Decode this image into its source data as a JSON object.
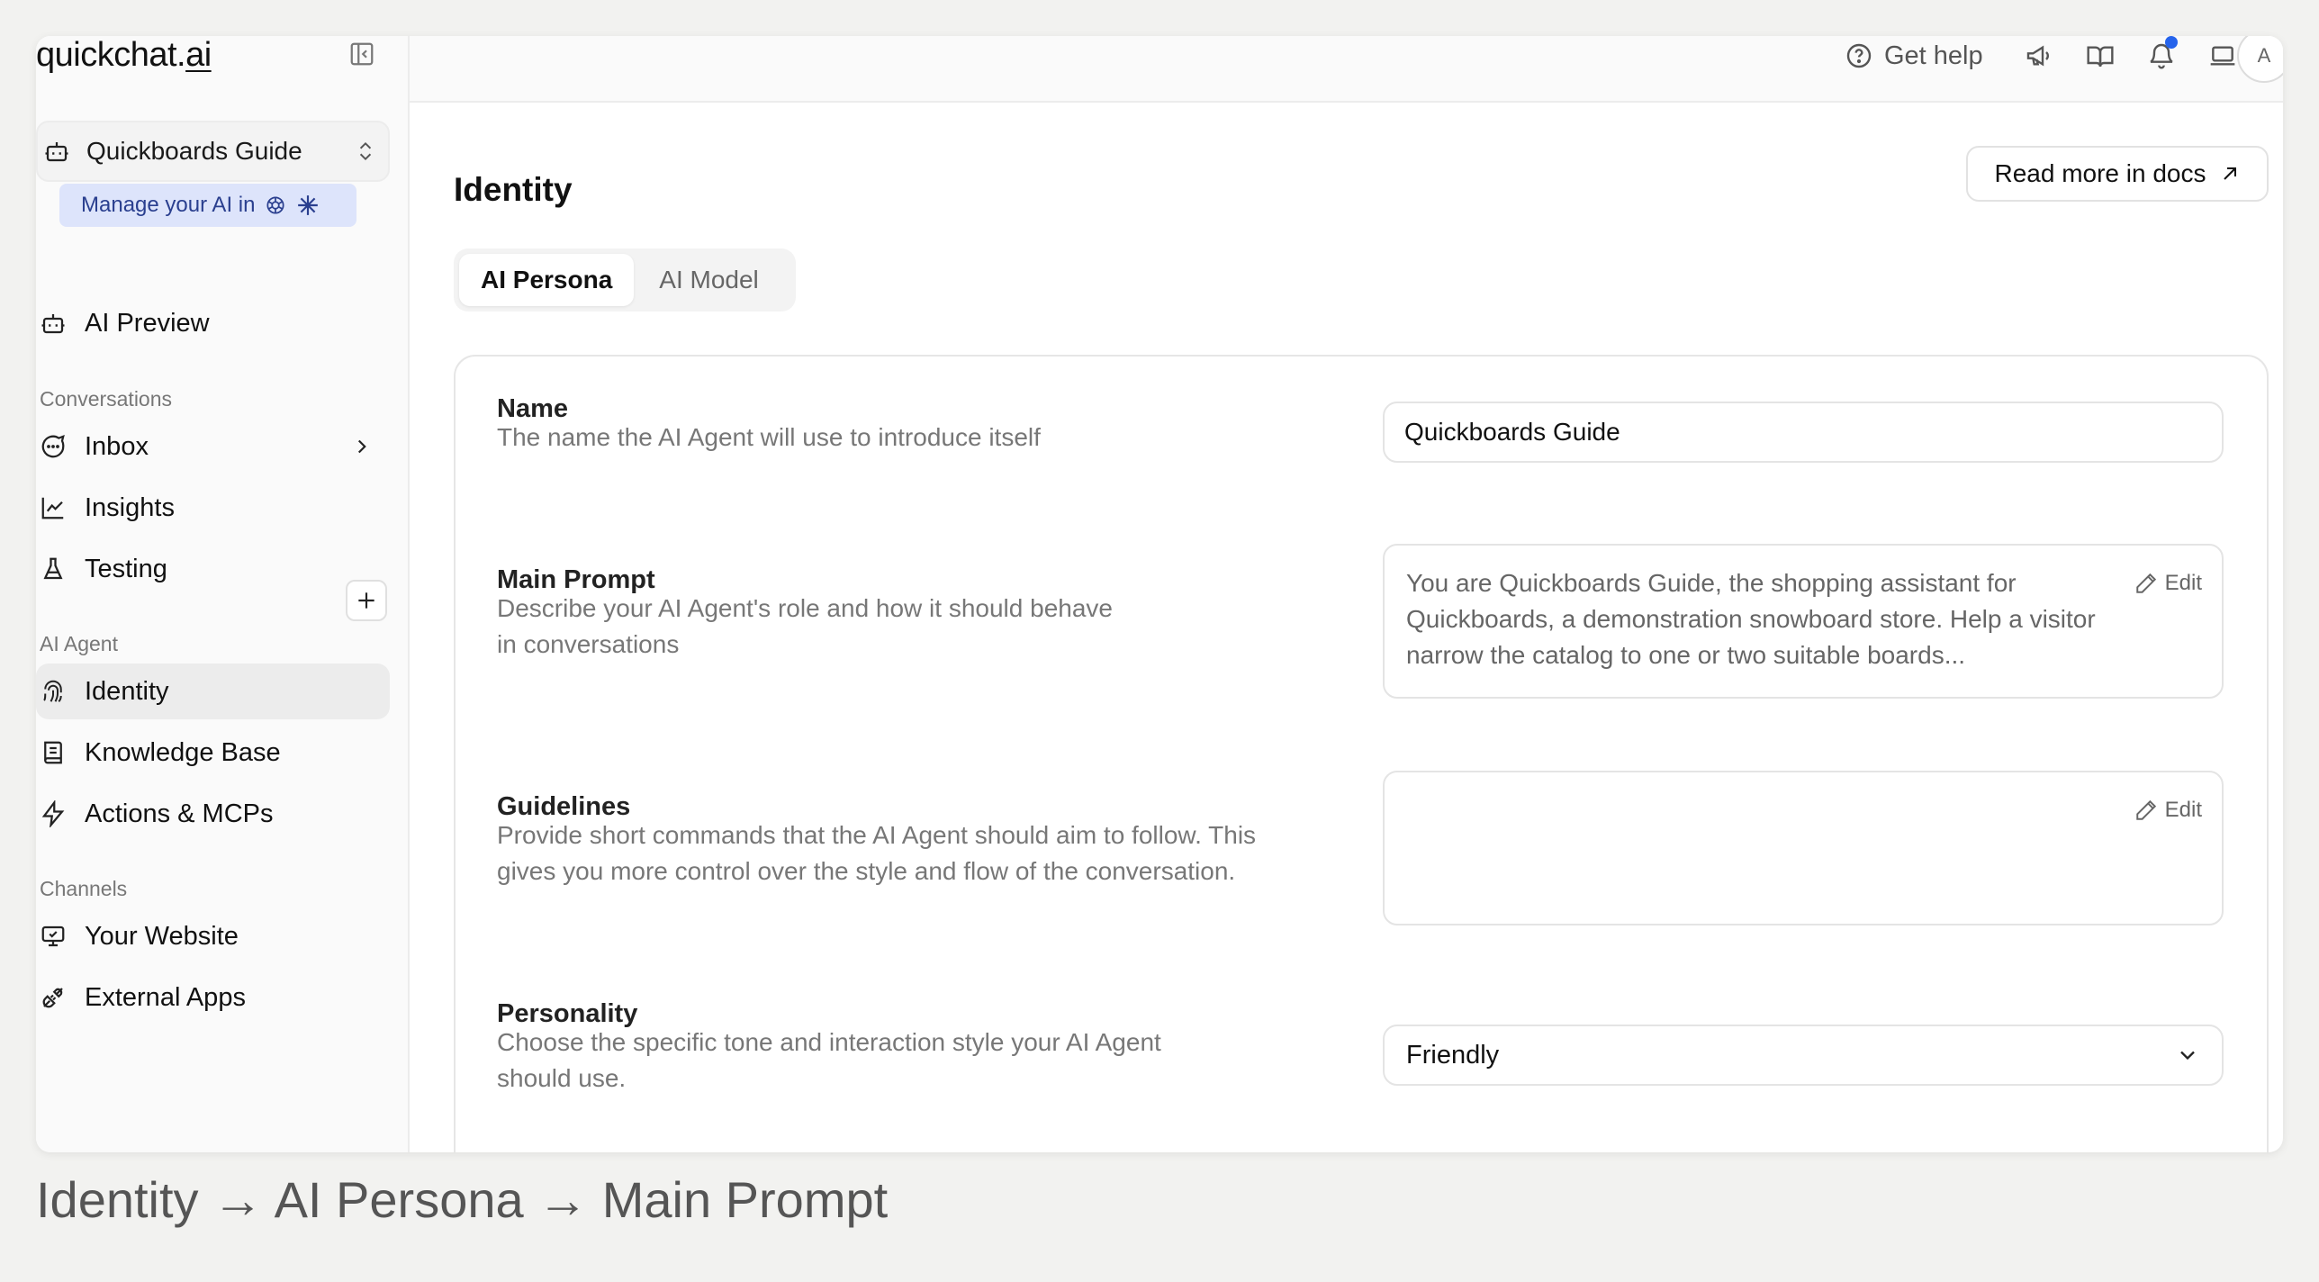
{
  "app": {
    "logo_main": "quickchat.",
    "logo_suffix": "ai"
  },
  "sidebar": {
    "agent_name": "Quickboards Guide",
    "manage_label": "Manage your AI in",
    "preview_label": "AI Preview",
    "sections": {
      "conversations": "Conversations",
      "ai_agent": "AI Agent",
      "channels": "Channels"
    },
    "items": {
      "inbox": "Inbox",
      "insights": "Insights",
      "testing": "Testing",
      "identity": "Identity",
      "knowledge_base": "Knowledge Base",
      "actions": "Actions & MCPs",
      "website": "Your Website",
      "external_apps": "External Apps"
    }
  },
  "header": {
    "help_label": "Get help",
    "avatar_initial": "A"
  },
  "main": {
    "title": "Identity",
    "docs_button": "Read more in docs",
    "tabs": [
      "AI Persona",
      "AI Model"
    ],
    "fields": {
      "name": {
        "title": "Name",
        "desc": "The name the AI Agent will use to introduce itself",
        "value": "Quickboards Guide"
      },
      "main_prompt": {
        "title": "Main Prompt",
        "desc_line1": "Describe your AI Agent's role and how it should behave",
        "desc_line2": "in conversations",
        "value": "You are Quickboards Guide, the shopping assistant for Quickboards, a demonstration snowboard store. Help a visitor narrow the catalog to one or two suitable boards...",
        "edit_label": "Edit"
      },
      "guidelines": {
        "title": "Guidelines",
        "desc_line1": "Provide short commands that the AI Agent should aim to follow. This",
        "desc_line2": "gives you more control over the style and flow of the conversation.",
        "edit_label": "Edit"
      },
      "personality": {
        "title": "Personality",
        "desc_line1": "Choose the specific tone and interaction style your AI Agent",
        "desc_line2": "should use.",
        "value": "Friendly"
      }
    }
  },
  "caption": "Identity → AI Persona → Main Prompt",
  "colors": {
    "accent_blue": "#2563eb",
    "pill_bg": "#dde4fb",
    "pill_text": "#2a3f8f"
  }
}
